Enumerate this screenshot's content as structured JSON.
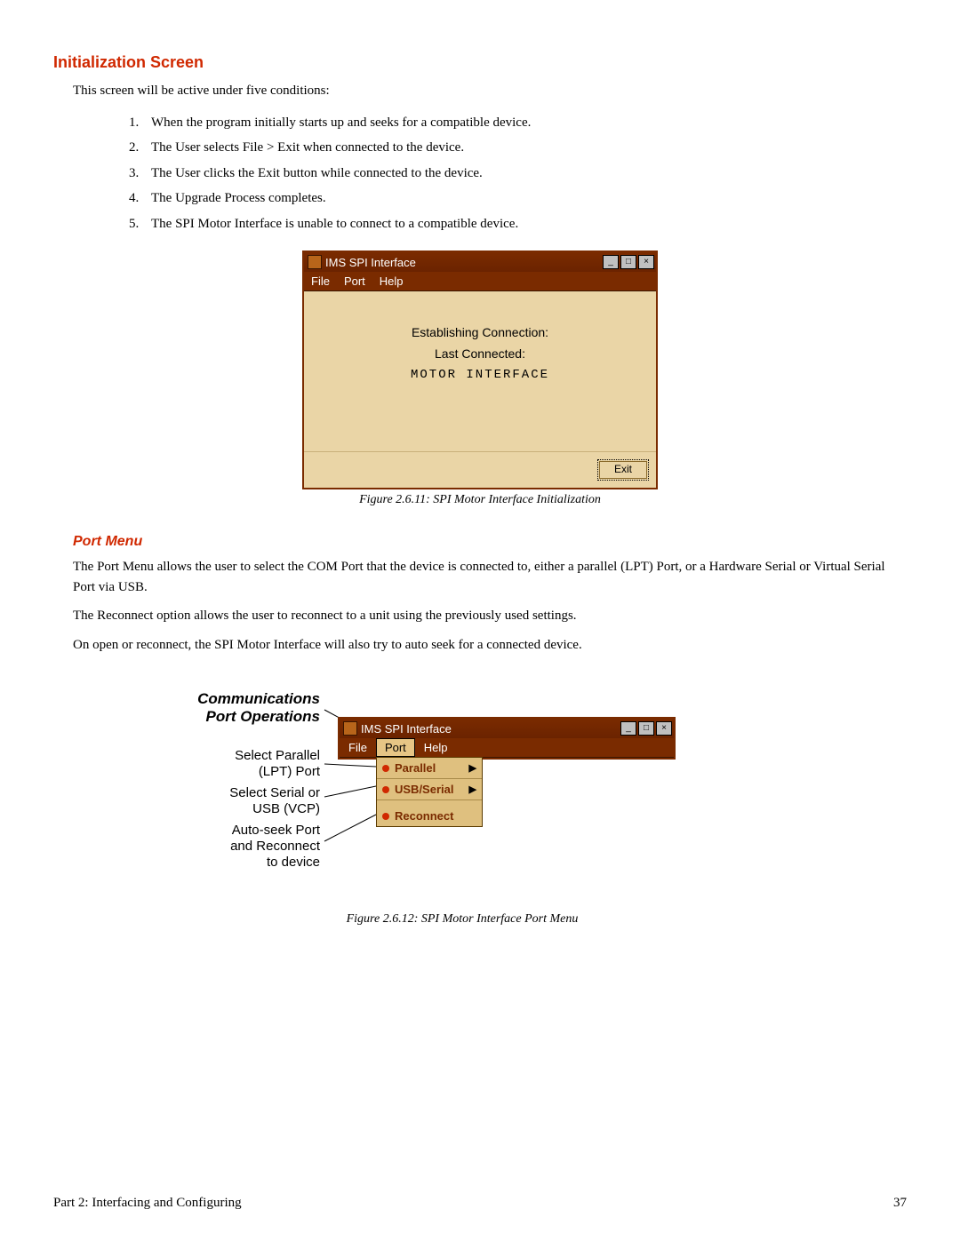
{
  "headings": {
    "init_screen": "Initialization Screen",
    "port_menu": "Port Menu"
  },
  "intro": "This screen will be active under five conditions:",
  "conditions": [
    "When the program initially starts up and seeks for a compatible device.",
    "The User selects File > Exit when connected to the device.",
    "The User clicks the Exit button while connected to the device.",
    "The Upgrade Process completes.",
    "The SPI Motor Interface is unable to connect to a compatible device."
  ],
  "fig1": {
    "window_title": "IMS SPI Interface",
    "menu": {
      "file": "File",
      "port": "Port",
      "help": "Help"
    },
    "client": {
      "establishing": "Establishing Connection:",
      "last_connected": "Last Connected:",
      "motor": "MOTOR INTERFACE"
    },
    "exit_label": "Exit",
    "caption": "Figure 2.6.11: SPI Motor Interface Initialization"
  },
  "port_section": {
    "p1": "The Port Menu allows the user to select the COM Port that the device is connected to, either a parallel (LPT) Port, or a Hardware Serial or Virtual Serial Port via USB.",
    "p2": "The Reconnect option allows the user to reconnect to a unit using the previously used settings.",
    "p3": "On open or reconnect, the SPI Motor Interface will also try to auto seek for a connected device."
  },
  "fig2": {
    "labels": {
      "title_l1": "Communications",
      "title_l2": "Port Operations",
      "parallel_l1": "Select Parallel",
      "parallel_l2": "(LPT) Port",
      "serial_l1": "Select Serial or",
      "serial_l2": "USB (VCP)",
      "reconnect_l1": "Auto-seek Port",
      "reconnect_l2": "and Reconnect",
      "reconnect_l3": "to device"
    },
    "window_title": "IMS SPI Interface",
    "menu": {
      "file": "File",
      "port": "Port",
      "help": "Help"
    },
    "dropdown": {
      "parallel": "Parallel",
      "usb": "USB/Serial",
      "reconnect": "Reconnect"
    },
    "caption": "Figure 2.6.12: SPI Motor Interface Port Menu"
  },
  "footer": {
    "left": "Part 2: Interfacing and Configuring",
    "page": "37"
  },
  "winbtns": {
    "min": "_",
    "max": "□",
    "close": "×"
  }
}
